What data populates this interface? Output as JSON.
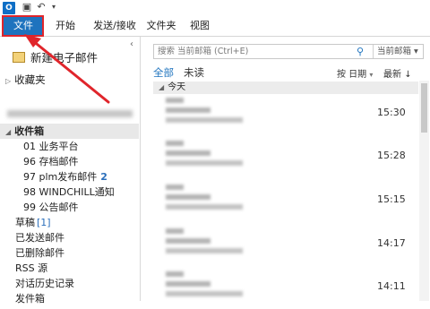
{
  "ribbon": {
    "tabs": [
      "文件",
      "开始",
      "发送/接收",
      "文件夹",
      "视图"
    ]
  },
  "nav": {
    "new_mail": "新建电子邮件",
    "favorites": "收藏夹",
    "inbox": "收件箱",
    "subfolders": [
      {
        "label": "01 业务平台"
      },
      {
        "label": "96 存档邮件"
      },
      {
        "label": "97 plm发布邮件",
        "count": "2"
      },
      {
        "label": "98 WINDCHILL通知"
      },
      {
        "label": "99 公告邮件"
      }
    ],
    "folders": [
      {
        "label": "草稿",
        "count": "[1]"
      },
      {
        "label": "已发送邮件"
      },
      {
        "label": "已删除邮件"
      },
      {
        "label": "RSS 源"
      },
      {
        "label": "对话历史记录"
      },
      {
        "label": "发件箱"
      }
    ]
  },
  "search": {
    "placeholder": "搜索 当前邮箱 (Ctrl+E)",
    "scope": "当前邮箱"
  },
  "filters": {
    "all": "全部",
    "unread": "未读"
  },
  "sort": {
    "by": "按 日期",
    "order": "最新"
  },
  "group": "今天",
  "messages": [
    {
      "time": "15:30"
    },
    {
      "time": "15:28"
    },
    {
      "time": "15:15"
    },
    {
      "time": "14:17"
    },
    {
      "time": "14:11"
    }
  ],
  "colors": {
    "accent": "#1e73be",
    "annotation": "#e0252b"
  }
}
